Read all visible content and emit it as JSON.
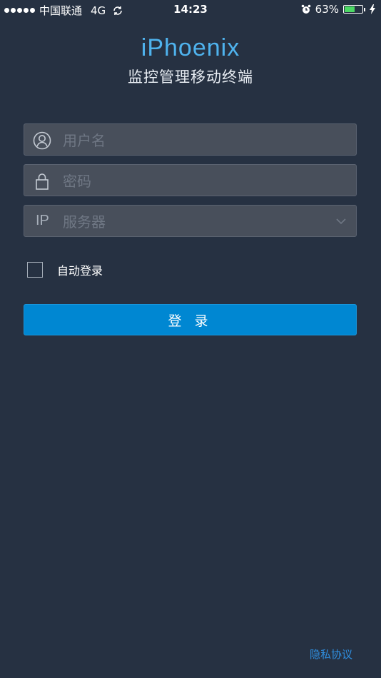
{
  "status_bar": {
    "carrier": "中国联通",
    "network": "4G",
    "time": "14:23",
    "battery": "63%",
    "battery_level": 0.63
  },
  "header": {
    "title": "iPhoenix",
    "subtitle": "监控管理移动终端"
  },
  "form": {
    "username_placeholder": "用户名",
    "password_placeholder": "密码",
    "server_label": "IP",
    "server_placeholder": "服务器",
    "auto_login_label": "自动登录",
    "login_button": "登 录"
  },
  "footer": {
    "privacy_link": "隐私协议"
  },
  "colors": {
    "background": "#263142",
    "accent": "#0087d2",
    "title": "#4fb3ee"
  }
}
